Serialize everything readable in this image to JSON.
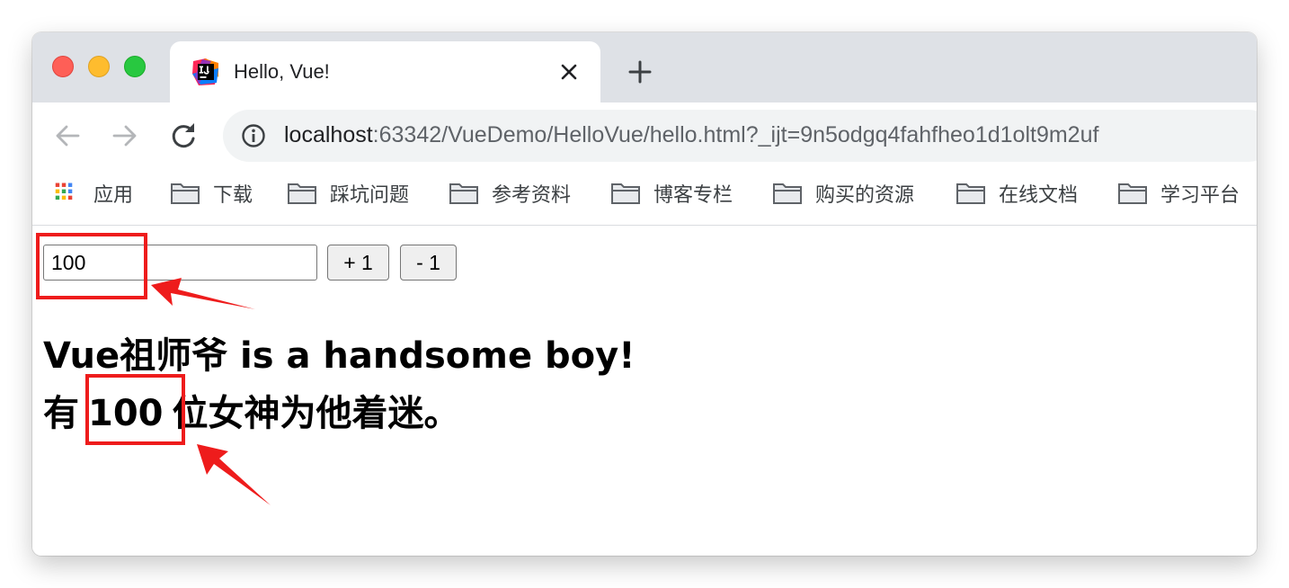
{
  "window": {
    "tab": {
      "title": "Hello, Vue!",
      "favicon": "intellij-icon"
    }
  },
  "toolbar": {
    "url_host": "localhost",
    "url_rest": ":63342/VueDemo/HelloVue/hello.html?_ijt=9n5odgq4fahfheo1d1olt9m2uf"
  },
  "bookmarks": {
    "items": [
      {
        "label": "应用",
        "icon": "apps-grid-icon"
      },
      {
        "label": "下载",
        "icon": "folder-icon"
      },
      {
        "label": "踩坑问题",
        "icon": "folder-icon"
      },
      {
        "label": "参考资料",
        "icon": "folder-icon"
      },
      {
        "label": "博客专栏",
        "icon": "folder-icon"
      },
      {
        "label": "购买的资源",
        "icon": "folder-icon"
      },
      {
        "label": "在线文档",
        "icon": "folder-icon"
      },
      {
        "label": "学习平台",
        "icon": "folder-icon"
      }
    ]
  },
  "page": {
    "input_value": "100",
    "plus_label": "+ 1",
    "minus_label": "- 1",
    "headline1": "Vue祖师爷 is a handsome boy!",
    "headline2_prefix": "有",
    "headline2_count": "100",
    "headline2_suffix": "位女神为他着迷。"
  },
  "colors": {
    "annotation": "#ee1c1c",
    "tabstrip": "#dee1e6",
    "omnibox": "#f1f3f4"
  }
}
